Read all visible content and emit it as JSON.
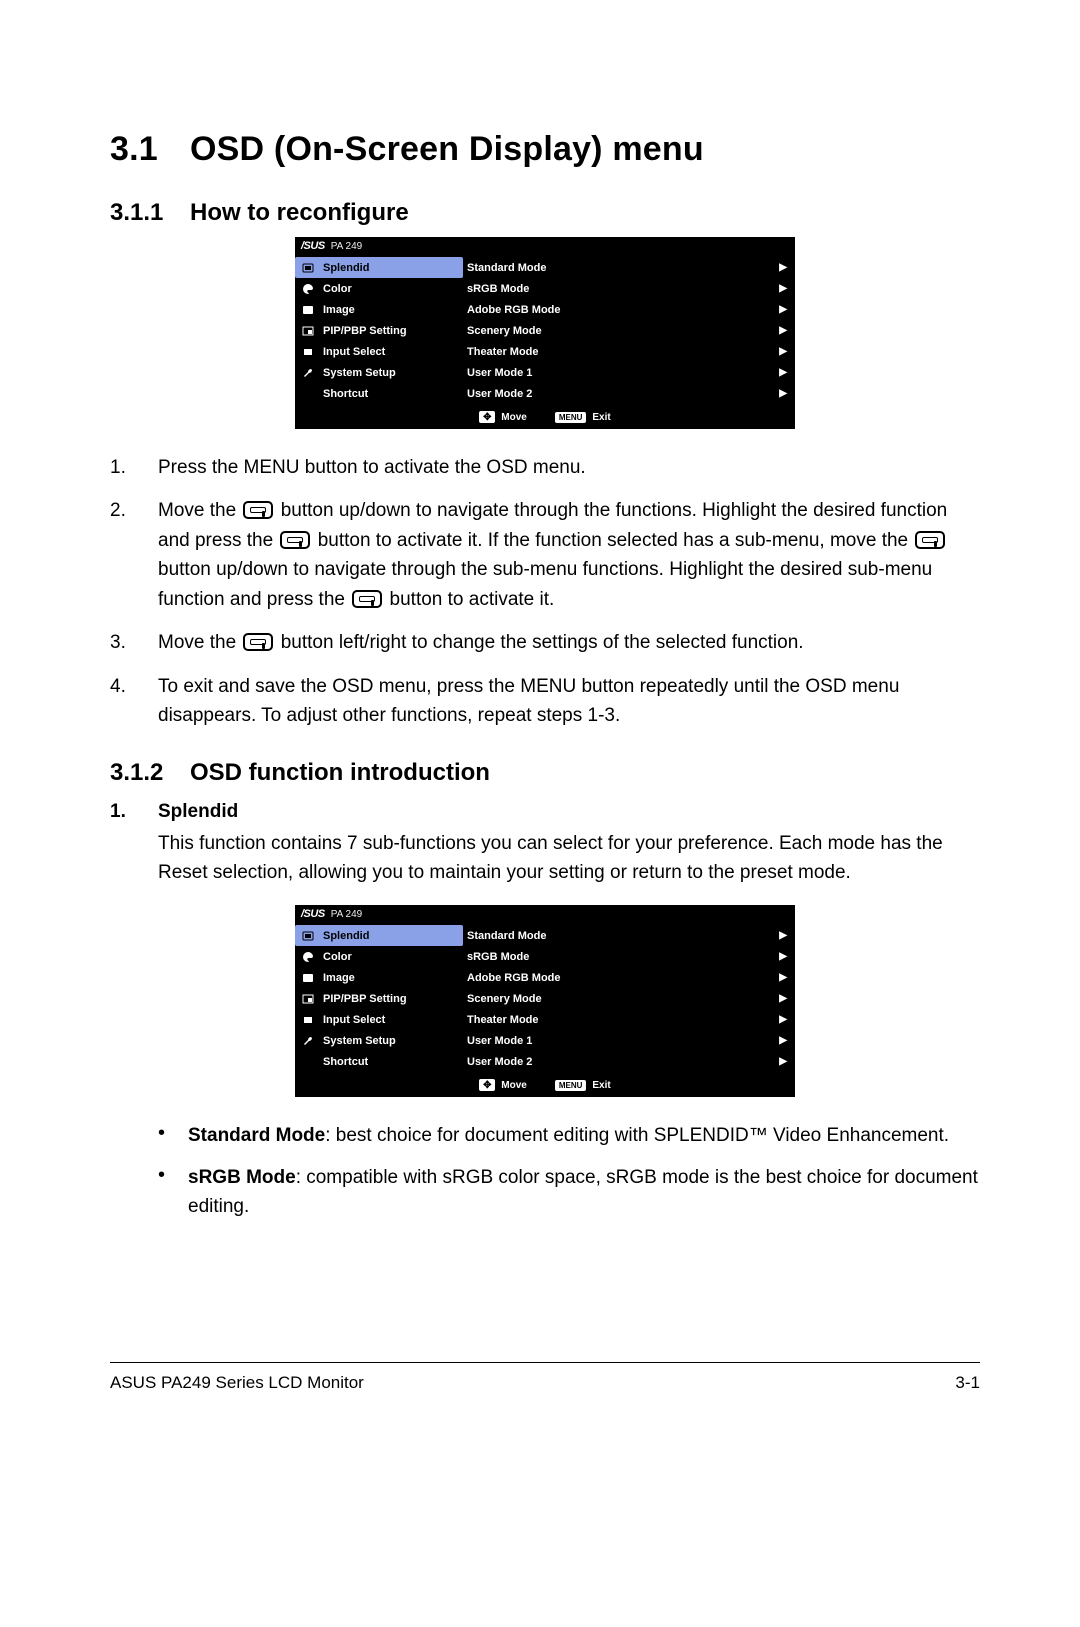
{
  "section": {
    "number": "3.1",
    "title": "OSD (On-Screen Display) menu"
  },
  "sub1": {
    "number": "3.1.1",
    "title": "How to reconfigure"
  },
  "sub2": {
    "number": "3.1.2",
    "title": "OSD function introduction"
  },
  "osd": {
    "brand": "/SUS",
    "model": "PA 249",
    "left": [
      {
        "label": "Splendid",
        "selected": true
      },
      {
        "label": "Color",
        "selected": false
      },
      {
        "label": "Image",
        "selected": false
      },
      {
        "label": "PIP/PBP Setting",
        "selected": false
      },
      {
        "label": "Input Select",
        "selected": false
      },
      {
        "label": "System Setup",
        "selected": false
      },
      {
        "label": "Shortcut",
        "selected": false
      }
    ],
    "right": [
      "Standard Mode",
      "sRGB Mode",
      "Adobe RGB Mode",
      "Scenery Mode",
      "Theater Mode",
      "User Mode 1",
      "User Mode 2"
    ],
    "footer": {
      "move": "Move",
      "exit": "Exit",
      "exitBtn": "MENU"
    }
  },
  "steps": {
    "n1": "1.",
    "t1": "Press the MENU button to activate the OSD menu.",
    "n2": "2.",
    "t2a": "Move the ",
    "t2b": " button up/down to navigate through the functions. Highlight the desired function and press the ",
    "t2c": " button to activate it. If the function selected has a sub-menu, move the ",
    "t2d": " button up/down to navigate through the sub-menu functions. Highlight the desired sub-menu function and press the ",
    "t2e": " button to activate it.",
    "n3": "3.",
    "t3a": "Move the ",
    "t3b": " button left/right to change the settings of the selected function.",
    "n4": "4.",
    "t4": "To exit and save the OSD menu, press the MENU button repeatedly until the OSD menu disappears. To adjust other functions, repeat steps 1-3."
  },
  "splendid": {
    "hnum": "1.",
    "hlab": "Splendid",
    "intro": "This function contains 7 sub-functions you can select for your preference. Each mode has the Reset selection, allowing you to maintain your setting or return to the preset mode.",
    "b1s": "Standard Mode",
    "b1r": ": best choice for document editing with SPLENDID™ Video Enhancement.",
    "b2s": "sRGB Mode",
    "b2r": ": compatible with sRGB color space, sRGB mode is the best choice for document editing."
  },
  "footer": {
    "left": "ASUS PA249 Series LCD Monitor",
    "right": "3-1"
  }
}
